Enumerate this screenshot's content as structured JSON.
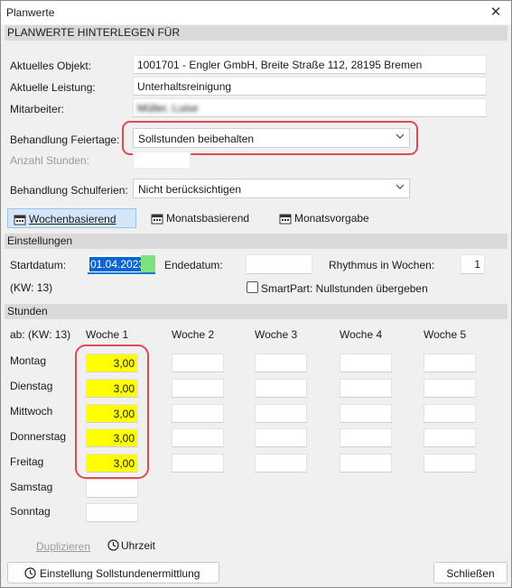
{
  "window": {
    "title": "Planwerte",
    "close_symbol": "✕"
  },
  "header": {
    "section_title": "PLANWERTE HINTERLEGEN FÜR"
  },
  "form": {
    "objekt_label": "Aktuelles Objekt:",
    "objekt_value": "1001701 - Engler GmbH, Breite Straße 112, 28195 Bremen",
    "leistung_label": "Aktuelle Leistung:",
    "leistung_value": "Unterhaltsreinigung",
    "mitarbeiter_label": "Mitarbeiter:",
    "mitarbeiter_value": "Müller, Luise",
    "feiertage_label": "Behandlung Feiertage:",
    "feiertage_value": "Sollstunden beibehalten",
    "anzahl_label": "Anzahl Stunden:",
    "schulferien_label": "Behandlung Schulferien:",
    "schulferien_value": "Nicht berücksichtigen"
  },
  "tabs": [
    {
      "label": "Wochenbasierend",
      "icon": "calendar-icon",
      "active": true
    },
    {
      "label": "Monatsbasierend",
      "icon": "calendar-icon",
      "active": false
    },
    {
      "label": "Monatsvorgabe",
      "icon": "calendar-icon",
      "active": false
    }
  ],
  "settings": {
    "section_title": "Einstellungen",
    "start_label": "Startdatum:",
    "start_value": "01.04.2023",
    "end_label": "Endedatum:",
    "end_value": "",
    "rhythm_label": "Rhythmus in Wochen:",
    "rhythm_value": "1",
    "kw_label": "(KW: 13)",
    "smartpart_label": "SmartPart: Nullstunden übergeben",
    "smartpart_checked": false
  },
  "hours": {
    "section_title": "Stunden",
    "from_label": "ab: (KW: 13)",
    "weeks": [
      "Woche 1",
      "Woche 2",
      "Woche 3",
      "Woche 4",
      "Woche 5"
    ],
    "days": [
      {
        "name": "Montag",
        "values": [
          "3,00",
          "",
          "",
          "",
          ""
        ]
      },
      {
        "name": "Dienstag",
        "values": [
          "3,00",
          "",
          "",
          "",
          ""
        ]
      },
      {
        "name": "Mittwoch",
        "values": [
          "3,00",
          "",
          "",
          "",
          ""
        ]
      },
      {
        "name": "Donnerstag",
        "values": [
          "3,00",
          "",
          "",
          "",
          ""
        ]
      },
      {
        "name": "Freitag",
        "values": [
          "3,00",
          "",
          "",
          "",
          ""
        ]
      },
      {
        "name": "Samstag",
        "values": [
          "",
          "",
          "",
          "",
          ""
        ]
      },
      {
        "name": "Sonntag",
        "values": [
          "",
          "",
          "",
          "",
          ""
        ]
      }
    ]
  },
  "footer": {
    "duplicate_label": "Duplizieren",
    "time_label": "Uhrzeit",
    "settings_button": "Einstellung Sollstundenermittlung",
    "close_button": "Schließen"
  },
  "colors": {
    "highlight_yellow": "#ffff00",
    "annotation_red": "#e04a52",
    "active_tab": "#d4e6f8",
    "selection_blue": "#0a64d4"
  }
}
